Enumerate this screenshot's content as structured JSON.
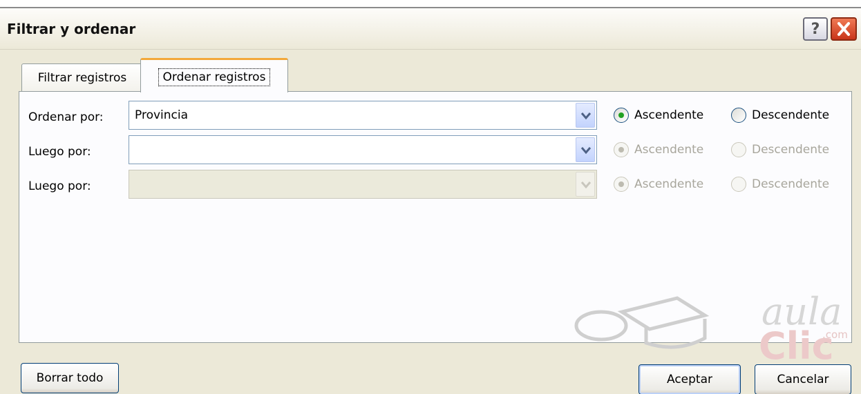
{
  "window": {
    "title": "Filtrar y ordenar",
    "help_glyph": "?"
  },
  "tabs": [
    {
      "label": "Filtrar registros",
      "mnemonic": "i",
      "active": false
    },
    {
      "label": "Ordenar registros",
      "mnemonic": "r",
      "active": true
    }
  ],
  "sort_rows": [
    {
      "label": "Ordenar por:",
      "value": "Provincia",
      "enabled": true,
      "ascending_label": "Ascendente",
      "descending_label": "Descendente",
      "selected": "ascending"
    },
    {
      "label": "Luego por:",
      "value": "",
      "enabled": true,
      "ascending_label": "Ascendente",
      "descending_label": "Descendente",
      "selected": "ascending"
    },
    {
      "label": "Luego por:",
      "value": "",
      "enabled": false,
      "ascending_label": "Ascendente",
      "descending_label": "Descendente",
      "selected": "ascending"
    }
  ],
  "buttons": {
    "clear_all": "Borrar todo",
    "ok": "Aceptar",
    "cancel": "Cancelar"
  },
  "watermark": {
    "brand_top": "aula",
    "brand_bottom": "Clic",
    "brand_small": ".com"
  },
  "colors": {
    "dialog_bg": "#ece9d8",
    "panel_bg": "#fcfcfe",
    "active_tab_accent": "#f3a83a",
    "selected_radio": "#21a121",
    "close_button": "#c9351a"
  }
}
